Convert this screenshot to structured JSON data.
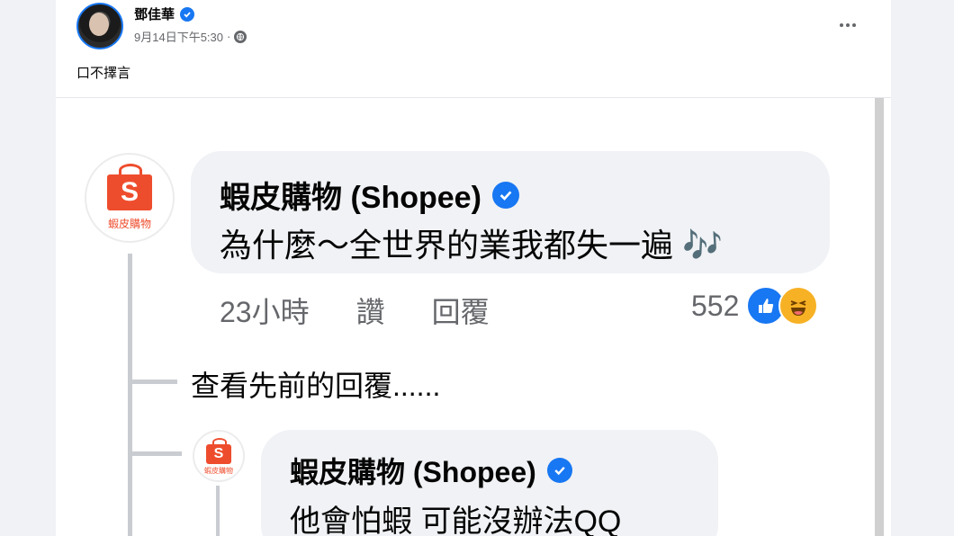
{
  "post": {
    "author": "鄧佳華",
    "timestamp": "9月14日下午5:30",
    "separator": "·",
    "caption": "口不擇言",
    "icons": {
      "verified": "verified-badge-icon",
      "audience": "globe-icon",
      "more": "more-options-icon"
    }
  },
  "screenshot": {
    "comment": {
      "name": "蝦皮購物 (Shopee)",
      "text": "為什麼～全世界的業我都失一遍 🎶",
      "time": "23小時",
      "like": "讚",
      "reply": "回覆",
      "reaction_count": "552",
      "avatar_label": "蝦皮購物"
    },
    "view_previous": "查看先前的回覆......",
    "reply": {
      "name": "蝦皮購物 (Shopee)",
      "text": "他會怕蝦 可能沒辦法QQ",
      "avatar_label": "蝦皮購物"
    },
    "brand_letter": "S"
  },
  "colors": {
    "facebook_blue": "#1877f2",
    "shopee_orange": "#ee4d2d",
    "haha_yellow": "#f7b125"
  }
}
